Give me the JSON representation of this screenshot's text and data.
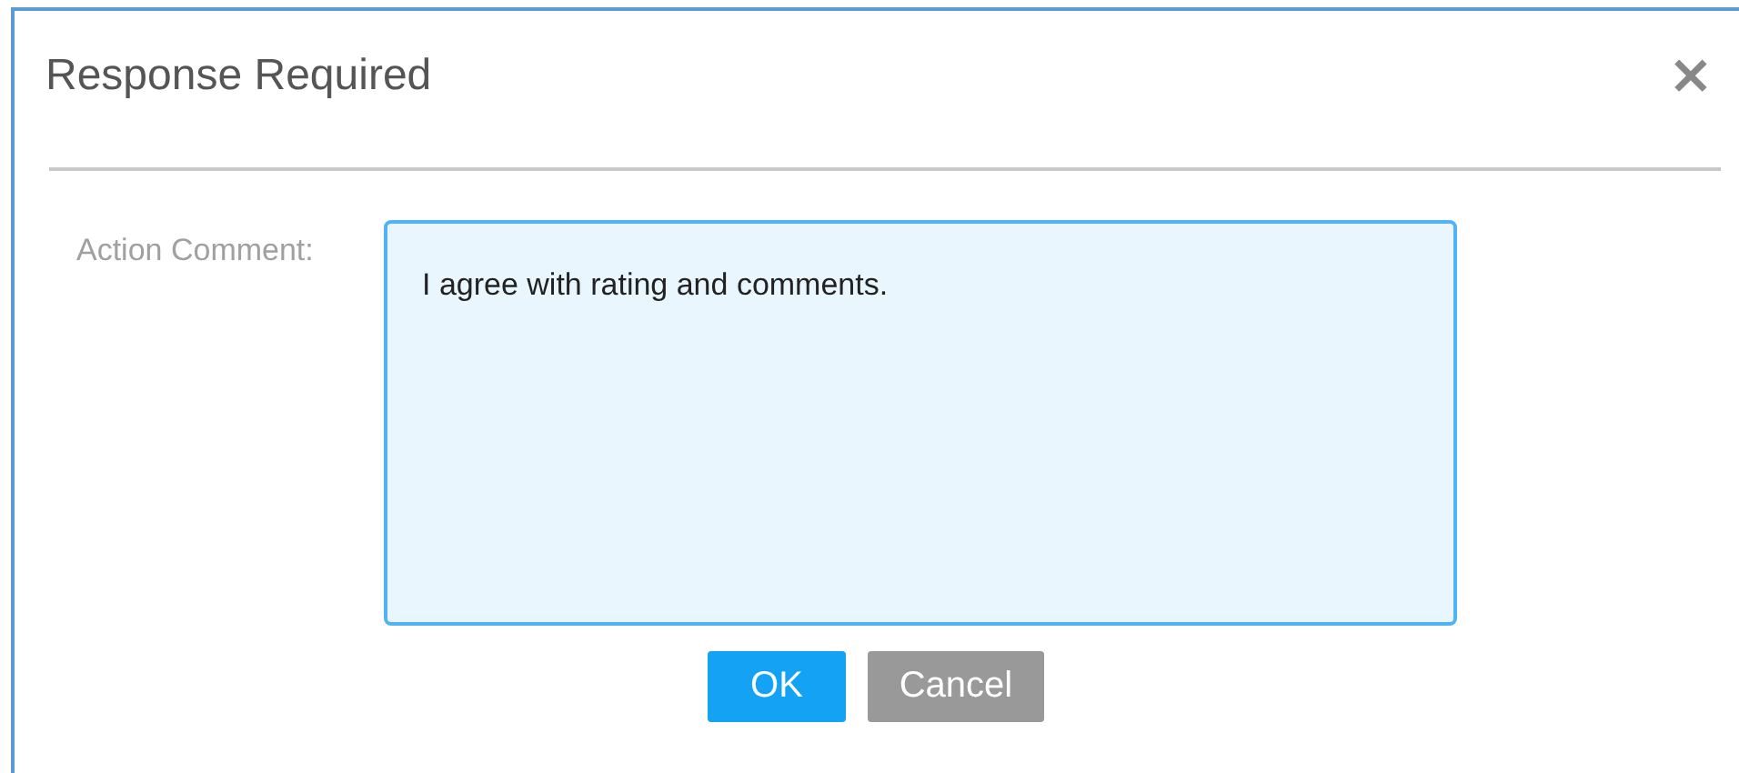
{
  "dialog": {
    "title": "Response Required",
    "close": "×"
  },
  "form": {
    "label": "Action Comment:",
    "value": "I agree with rating and comments."
  },
  "buttons": [
    {
      "label": "OK",
      "kind": "primary"
    },
    {
      "label": "Cancel",
      "kind": "secondary"
    }
  ]
}
